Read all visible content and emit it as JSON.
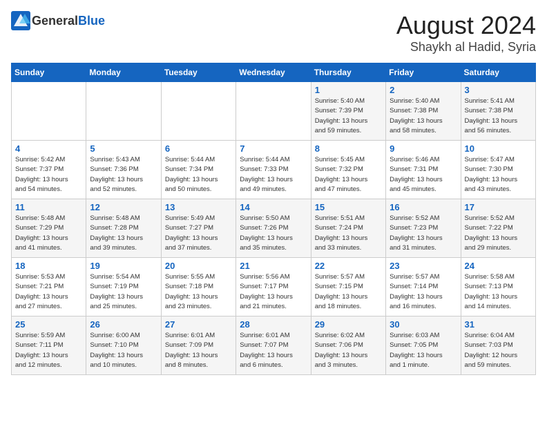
{
  "header": {
    "logo_general": "General",
    "logo_blue": "Blue",
    "month": "August 2024",
    "location": "Shaykh al Hadid, Syria"
  },
  "weekdays": [
    "Sunday",
    "Monday",
    "Tuesday",
    "Wednesday",
    "Thursday",
    "Friday",
    "Saturday"
  ],
  "weeks": [
    [
      {
        "day": "",
        "info": ""
      },
      {
        "day": "",
        "info": ""
      },
      {
        "day": "",
        "info": ""
      },
      {
        "day": "",
        "info": ""
      },
      {
        "day": "1",
        "info": "Sunrise: 5:40 AM\nSunset: 7:39 PM\nDaylight: 13 hours\nand 59 minutes."
      },
      {
        "day": "2",
        "info": "Sunrise: 5:40 AM\nSunset: 7:38 PM\nDaylight: 13 hours\nand 58 minutes."
      },
      {
        "day": "3",
        "info": "Sunrise: 5:41 AM\nSunset: 7:38 PM\nDaylight: 13 hours\nand 56 minutes."
      }
    ],
    [
      {
        "day": "4",
        "info": "Sunrise: 5:42 AM\nSunset: 7:37 PM\nDaylight: 13 hours\nand 54 minutes."
      },
      {
        "day": "5",
        "info": "Sunrise: 5:43 AM\nSunset: 7:36 PM\nDaylight: 13 hours\nand 52 minutes."
      },
      {
        "day": "6",
        "info": "Sunrise: 5:44 AM\nSunset: 7:34 PM\nDaylight: 13 hours\nand 50 minutes."
      },
      {
        "day": "7",
        "info": "Sunrise: 5:44 AM\nSunset: 7:33 PM\nDaylight: 13 hours\nand 49 minutes."
      },
      {
        "day": "8",
        "info": "Sunrise: 5:45 AM\nSunset: 7:32 PM\nDaylight: 13 hours\nand 47 minutes."
      },
      {
        "day": "9",
        "info": "Sunrise: 5:46 AM\nSunset: 7:31 PM\nDaylight: 13 hours\nand 45 minutes."
      },
      {
        "day": "10",
        "info": "Sunrise: 5:47 AM\nSunset: 7:30 PM\nDaylight: 13 hours\nand 43 minutes."
      }
    ],
    [
      {
        "day": "11",
        "info": "Sunrise: 5:48 AM\nSunset: 7:29 PM\nDaylight: 13 hours\nand 41 minutes."
      },
      {
        "day": "12",
        "info": "Sunrise: 5:48 AM\nSunset: 7:28 PM\nDaylight: 13 hours\nand 39 minutes."
      },
      {
        "day": "13",
        "info": "Sunrise: 5:49 AM\nSunset: 7:27 PM\nDaylight: 13 hours\nand 37 minutes."
      },
      {
        "day": "14",
        "info": "Sunrise: 5:50 AM\nSunset: 7:26 PM\nDaylight: 13 hours\nand 35 minutes."
      },
      {
        "day": "15",
        "info": "Sunrise: 5:51 AM\nSunset: 7:24 PM\nDaylight: 13 hours\nand 33 minutes."
      },
      {
        "day": "16",
        "info": "Sunrise: 5:52 AM\nSunset: 7:23 PM\nDaylight: 13 hours\nand 31 minutes."
      },
      {
        "day": "17",
        "info": "Sunrise: 5:52 AM\nSunset: 7:22 PM\nDaylight: 13 hours\nand 29 minutes."
      }
    ],
    [
      {
        "day": "18",
        "info": "Sunrise: 5:53 AM\nSunset: 7:21 PM\nDaylight: 13 hours\nand 27 minutes."
      },
      {
        "day": "19",
        "info": "Sunrise: 5:54 AM\nSunset: 7:19 PM\nDaylight: 13 hours\nand 25 minutes."
      },
      {
        "day": "20",
        "info": "Sunrise: 5:55 AM\nSunset: 7:18 PM\nDaylight: 13 hours\nand 23 minutes."
      },
      {
        "day": "21",
        "info": "Sunrise: 5:56 AM\nSunset: 7:17 PM\nDaylight: 13 hours\nand 21 minutes."
      },
      {
        "day": "22",
        "info": "Sunrise: 5:57 AM\nSunset: 7:15 PM\nDaylight: 13 hours\nand 18 minutes."
      },
      {
        "day": "23",
        "info": "Sunrise: 5:57 AM\nSunset: 7:14 PM\nDaylight: 13 hours\nand 16 minutes."
      },
      {
        "day": "24",
        "info": "Sunrise: 5:58 AM\nSunset: 7:13 PM\nDaylight: 13 hours\nand 14 minutes."
      }
    ],
    [
      {
        "day": "25",
        "info": "Sunrise: 5:59 AM\nSunset: 7:11 PM\nDaylight: 13 hours\nand 12 minutes."
      },
      {
        "day": "26",
        "info": "Sunrise: 6:00 AM\nSunset: 7:10 PM\nDaylight: 13 hours\nand 10 minutes."
      },
      {
        "day": "27",
        "info": "Sunrise: 6:01 AM\nSunset: 7:09 PM\nDaylight: 13 hours\nand 8 minutes."
      },
      {
        "day": "28",
        "info": "Sunrise: 6:01 AM\nSunset: 7:07 PM\nDaylight: 13 hours\nand 6 minutes."
      },
      {
        "day": "29",
        "info": "Sunrise: 6:02 AM\nSunset: 7:06 PM\nDaylight: 13 hours\nand 3 minutes."
      },
      {
        "day": "30",
        "info": "Sunrise: 6:03 AM\nSunset: 7:05 PM\nDaylight: 13 hours\nand 1 minute."
      },
      {
        "day": "31",
        "info": "Sunrise: 6:04 AM\nSunset: 7:03 PM\nDaylight: 12 hours\nand 59 minutes."
      }
    ]
  ]
}
